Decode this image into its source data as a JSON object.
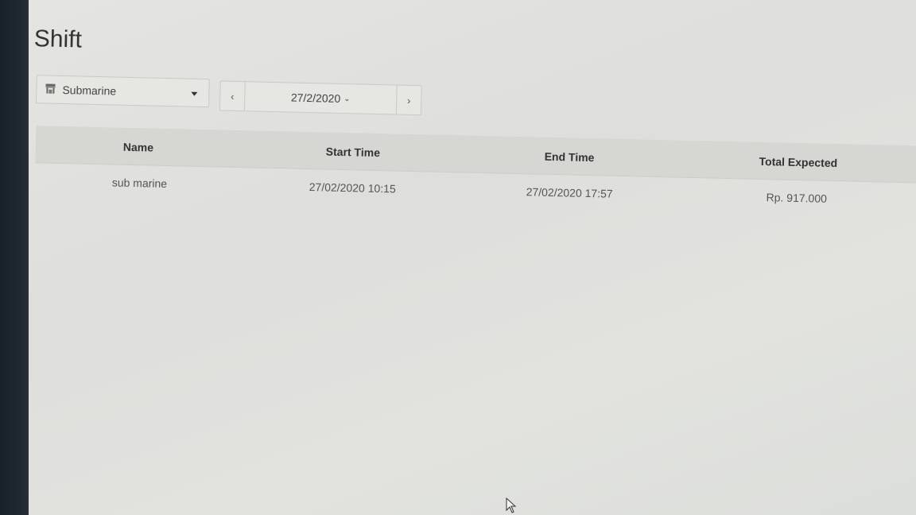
{
  "page": {
    "title": "Shift"
  },
  "store_select": {
    "value": "Submarine",
    "icon": "store-icon"
  },
  "date_nav": {
    "prev_label": "‹",
    "date": "27/2/2020",
    "next_label": "›"
  },
  "table": {
    "columns": [
      "Name",
      "Start Time",
      "End Time",
      "Total Expected"
    ],
    "rows": [
      {
        "name": "sub marine",
        "start": "27/02/2020 10:15",
        "end": "27/02/2020 17:57",
        "total": "Rp. 917.000"
      }
    ]
  }
}
